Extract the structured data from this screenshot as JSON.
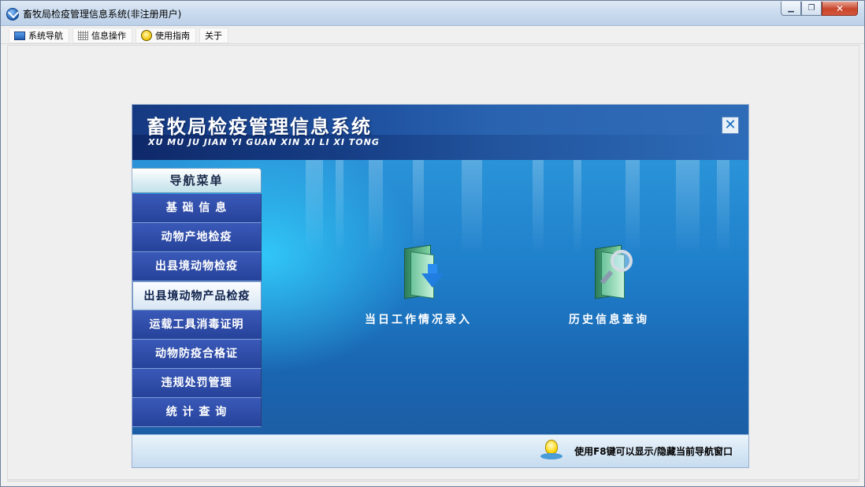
{
  "window": {
    "title": "畜牧局检疫管理信息系统(非注册用户)",
    "minimize_icon": "minimize-icon",
    "restore_icon": "restore-icon",
    "close_icon": "close-icon"
  },
  "menubar": {
    "items": [
      {
        "label": "系统导航",
        "icon": "monitor-icon"
      },
      {
        "label": "信息操作",
        "icon": "grid-icon"
      },
      {
        "label": "使用指南",
        "icon": "lightbulb-icon"
      },
      {
        "label": "关于",
        "icon": ""
      }
    ]
  },
  "panel": {
    "title": "畜牧局检疫管理信息系统",
    "subtitle": "XU MU JU JIAN YI GUAN  XIN XI LI XI TONG",
    "close_glyph": "✕"
  },
  "nav": {
    "title": "导航菜单",
    "items": [
      {
        "label": "基 础 信 息",
        "active": false
      },
      {
        "label": "动物产地检疫",
        "active": false
      },
      {
        "label": "出县境动物检疫",
        "active": false
      },
      {
        "label": "出县境动物产品检疫",
        "active": true
      },
      {
        "label": "运载工具消毒证明",
        "active": false
      },
      {
        "label": "动物防疫合格证",
        "active": false
      },
      {
        "label": "违规处罚管理",
        "active": false
      },
      {
        "label": "统 计 查 询",
        "active": false
      }
    ]
  },
  "actions": {
    "daily_entry": {
      "label": "当日工作情况录入",
      "icon": "folder-download-icon"
    },
    "history_query": {
      "label": "历史信息查询",
      "icon": "folder-search-icon"
    }
  },
  "footer": {
    "tip": "使用F8键可以显示/隐藏当前导航窗口",
    "icon": "lightbulb-icon"
  }
}
